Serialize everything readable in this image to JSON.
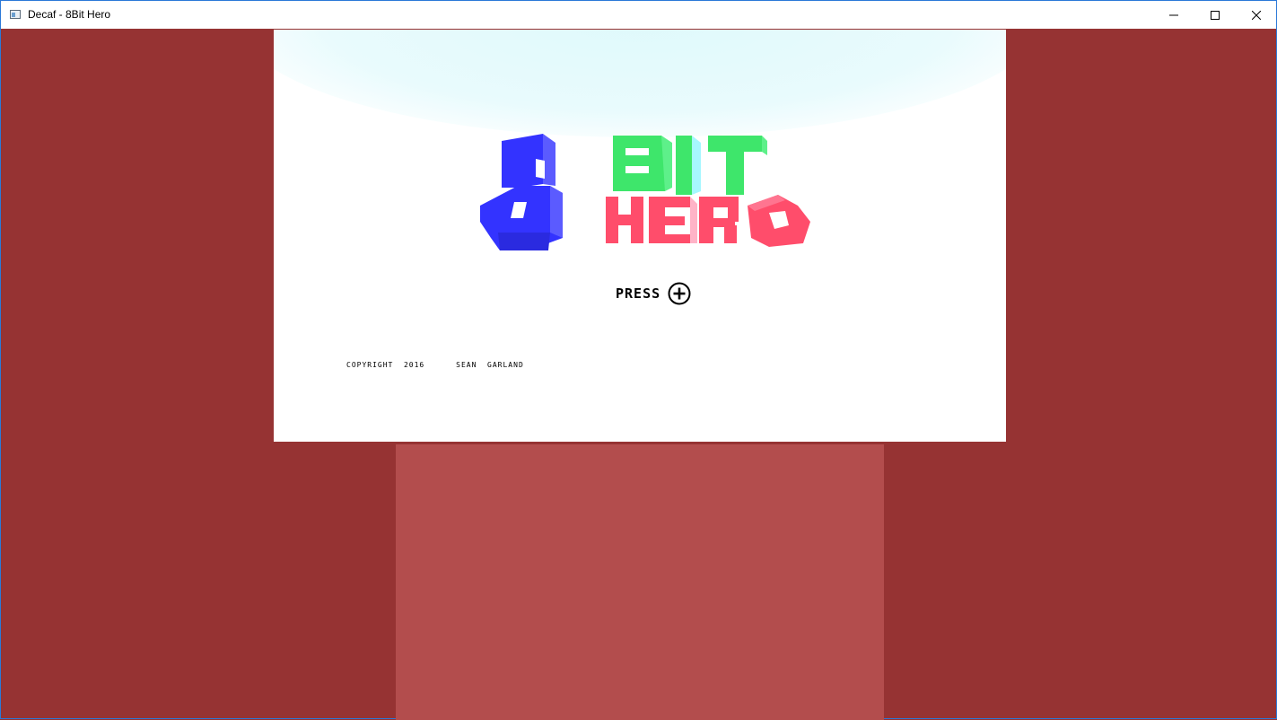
{
  "window": {
    "title": "Decaf - 8Bit Hero",
    "controls": [
      "minimize-icon",
      "maximize-icon",
      "close-icon"
    ]
  },
  "game": {
    "logo_text": {
      "number": "8",
      "word1": "BIT",
      "word2": "HERO"
    },
    "press_label": "PRESS",
    "press_button_icon": "plus-circle-icon",
    "copyright": "COPYRIGHT  2016      SEAN  GARLAND"
  },
  "colors": {
    "background": "#963333",
    "floor": "#b34d4d",
    "logo_blue": "#3333ff",
    "logo_green": "#3ee66b",
    "logo_red": "#ff4d6b"
  }
}
